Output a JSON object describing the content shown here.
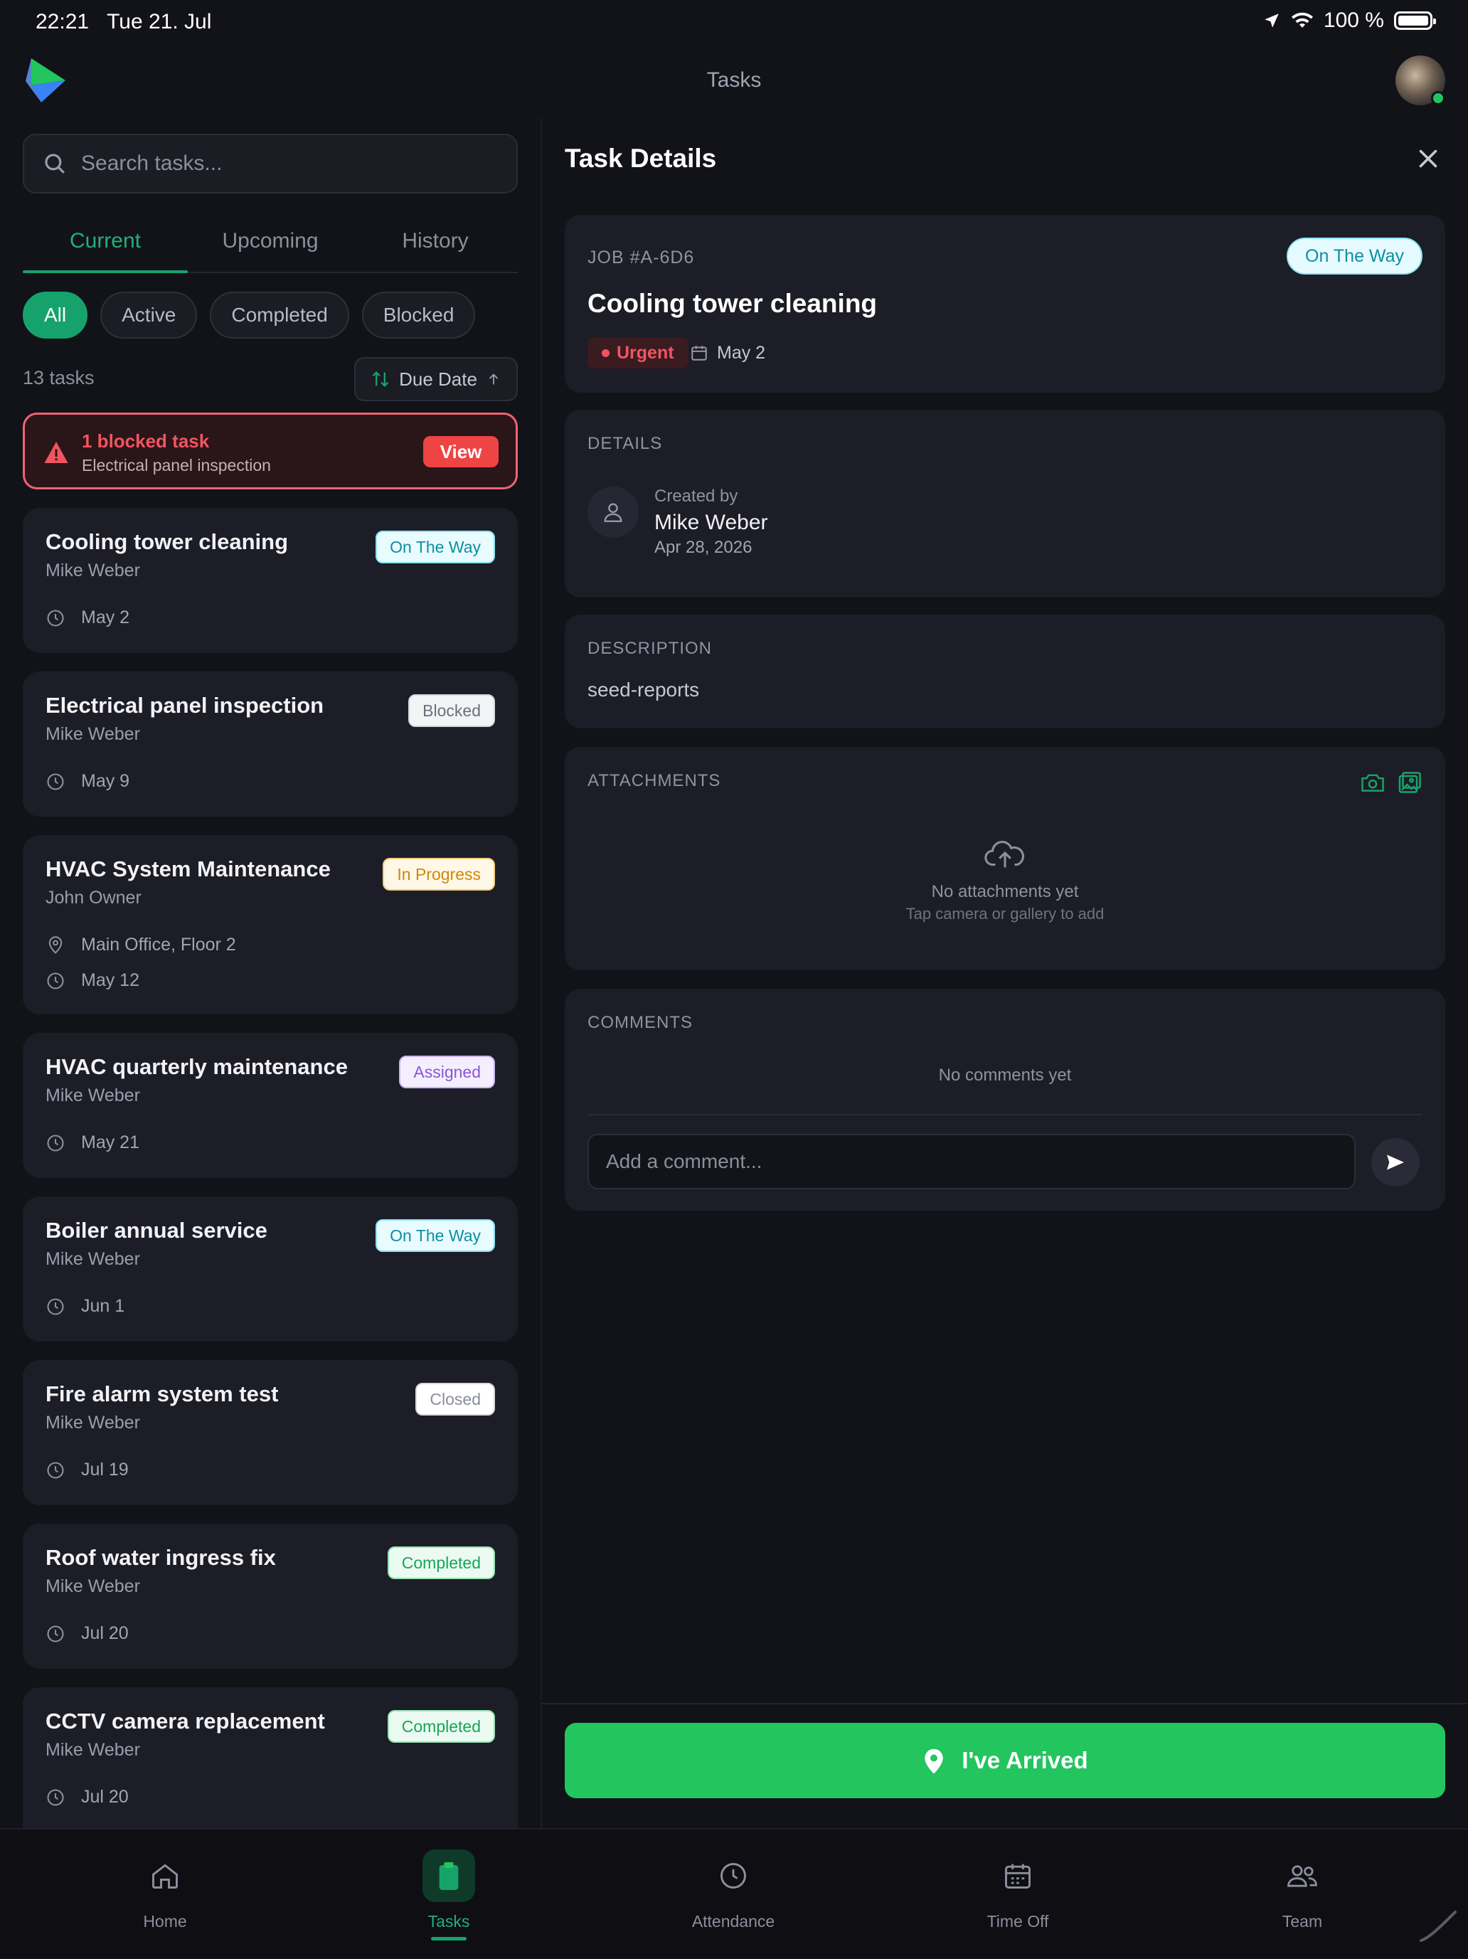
{
  "status_bar": {
    "time": "22:21",
    "date": "Tue 21. Jul",
    "battery": "100 %"
  },
  "header": {
    "title": "Tasks"
  },
  "search": {
    "placeholder": "Search tasks..."
  },
  "tabs": [
    {
      "label": "Current"
    },
    {
      "label": "Upcoming"
    },
    {
      "label": "History"
    }
  ],
  "filters": [
    {
      "label": "All"
    },
    {
      "label": "Active"
    },
    {
      "label": "Completed"
    },
    {
      "label": "Blocked"
    }
  ],
  "task_count": "13 tasks",
  "sort": {
    "label": "Due Date"
  },
  "blocked_alert": {
    "title": "1 blocked task",
    "subtitle": "Electrical panel inspection",
    "button": "View"
  },
  "tasks": [
    {
      "title": "Cooling tower cleaning",
      "assignee": "Mike Weber",
      "status": "On The Way",
      "date": "May 2"
    },
    {
      "title": "Electrical panel inspection",
      "assignee": "Mike Weber",
      "status": "Blocked",
      "date": "May 9"
    },
    {
      "title": "HVAC System Maintenance",
      "assignee": "John Owner",
      "status": "In Progress",
      "location": "Main Office, Floor 2",
      "date": "May 12"
    },
    {
      "title": "HVAC quarterly maintenance",
      "assignee": "Mike Weber",
      "status": "Assigned",
      "date": "May 21"
    },
    {
      "title": "Boiler annual service",
      "assignee": "Mike Weber",
      "status": "On The Way",
      "date": "Jun 1"
    },
    {
      "title": "Fire alarm system test",
      "assignee": "Mike Weber",
      "status": "Closed",
      "date": "Jul 19"
    },
    {
      "title": "Roof water ingress fix",
      "assignee": "Mike Weber",
      "status": "Completed",
      "date": "Jul 20"
    },
    {
      "title": "CCTV camera replacement",
      "assignee": "Mike Weber",
      "status": "Completed",
      "date": "Jul 20"
    }
  ],
  "detail": {
    "heading": "Task Details",
    "job_id": "JOB #A-6D6",
    "title": "Cooling tower cleaning",
    "status": "On The Way",
    "priority": "Urgent",
    "date": "May 2",
    "details_label": "DETAILS",
    "created_by_label": "Created by",
    "created_by": "Mike Weber",
    "created_date": "Apr 28, 2026",
    "description_label": "DESCRIPTION",
    "description": "seed-reports",
    "attachments_label": "ATTACHMENTS",
    "attachments_empty": "No attachments yet",
    "attachments_hint": "Tap camera or gallery to add",
    "comments_label": "COMMENTS",
    "comments_empty": "No comments yet",
    "comment_placeholder": "Add a comment...",
    "action_button": "I've Arrived"
  },
  "bottom_nav": [
    {
      "label": "Home",
      "icon": "home-icon"
    },
    {
      "label": "Tasks",
      "icon": "clipboard-icon"
    },
    {
      "label": "Attendance",
      "icon": "clock-icon"
    },
    {
      "label": "Time Off",
      "icon": "calendar-icon"
    },
    {
      "label": "Team",
      "icon": "users-icon"
    }
  ],
  "colors": {
    "accent": "#16a36b",
    "arrive": "#22c55e",
    "danger": "#ef4444",
    "background": "#121219",
    "card": "#1c1d26"
  }
}
